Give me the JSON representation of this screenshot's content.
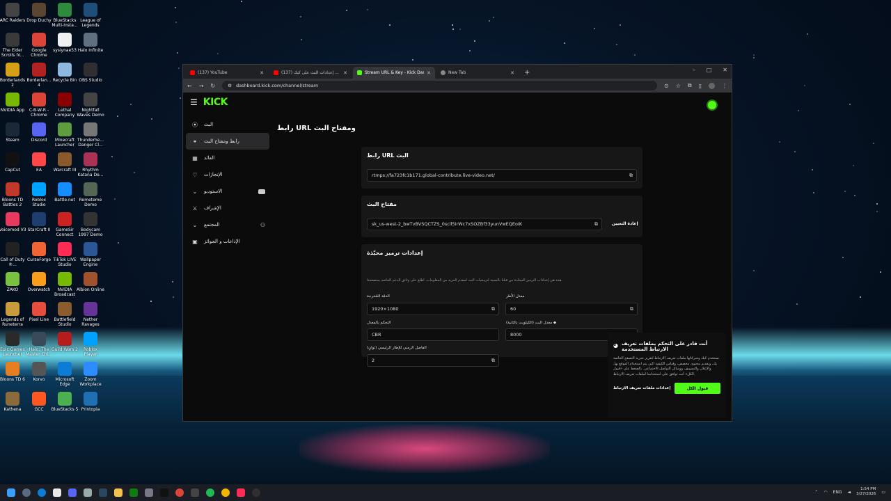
{
  "desktop_icons": [
    {
      "label": "ARC Raiders",
      "color": "#444444"
    },
    {
      "label": "Drop Duchy",
      "color": "#5a4630"
    },
    {
      "label": "BlueStacks Multi-Insta...",
      "color": "#2e8b3d"
    },
    {
      "label": "League of Legends",
      "color": "#1d4f7a"
    },
    {
      "label": "The Elder Scrolls IV...",
      "color": "#3a3a3a"
    },
    {
      "label": "Google Chrome",
      "color": "#db4437"
    },
    {
      "label": "sysiynae53",
      "color": "#f0f0f0"
    },
    {
      "label": "Halo Infinite",
      "color": "#607080"
    },
    {
      "label": "Borderlands 2",
      "color": "#d4a017"
    },
    {
      "label": "Borderlan... 4",
      "color": "#b22222"
    },
    {
      "label": "Recycle Bin",
      "color": "#8fb8de"
    },
    {
      "label": "OBS Studio",
      "color": "#302e31"
    },
    {
      "label": "NVIDIA App",
      "color": "#76b900"
    },
    {
      "label": "C-B-W-R - Chrome",
      "color": "#db4437"
    },
    {
      "label": "Lethal Company",
      "color": "#8b0000"
    },
    {
      "label": "Nightfall Waves Demo",
      "color": "#444444"
    },
    {
      "label": "Steam",
      "color": "#1b2838"
    },
    {
      "label": "Discord",
      "color": "#5865f2"
    },
    {
      "label": "Minecraft Launcher",
      "color": "#5d9c3f"
    },
    {
      "label": "Thunderhe... Danger Cl...",
      "color": "#777777"
    },
    {
      "label": "CapCut",
      "color": "#111111"
    },
    {
      "label": "EA",
      "color": "#ff4747"
    },
    {
      "label": "Warcraft III",
      "color": "#8b5a2b"
    },
    {
      "label": "Rhythm Katana De...",
      "color": "#aa3355"
    },
    {
      "label": "Bloons TD Battles 2",
      "color": "#c0392b"
    },
    {
      "label": "Roblox Studio",
      "color": "#00a2ff"
    },
    {
      "label": "Battle.net",
      "color": "#148eff"
    },
    {
      "label": "Remeteme Demo",
      "color": "#556655"
    },
    {
      "label": "Voicemod V3",
      "color": "#e83a5f"
    },
    {
      "label": "StarCraft II",
      "color": "#1d3e6e"
    },
    {
      "label": "GameSir Connect",
      "color": "#cc2222"
    },
    {
      "label": "Bodycam 1997 Demo",
      "color": "#333333"
    },
    {
      "label": "Call of Duty ®...",
      "color": "#222222"
    },
    {
      "label": "CurseForge",
      "color": "#f16436"
    },
    {
      "label": "TikTok LIVE Studio",
      "color": "#fe2c55"
    },
    {
      "label": "Wallpaper Engine",
      "color": "#2b5797"
    },
    {
      "label": "ZAKO",
      "color": "#7ac142"
    },
    {
      "label": "Overwatch",
      "color": "#f99e1a"
    },
    {
      "label": "NVIDIA Broadcast",
      "color": "#76b900"
    },
    {
      "label": "Albion Online",
      "color": "#a0522d"
    },
    {
      "label": "Legends of Runeterra",
      "color": "#c89b3c"
    },
    {
      "label": "Pixel Line",
      "color": "#e74c3c"
    },
    {
      "label": "Battlefield Studio",
      "color": "#8a5c2e"
    },
    {
      "label": "Nether Ravages",
      "color": "#663399"
    },
    {
      "label": "Epic Games Launcher",
      "color": "#2a2a2a"
    },
    {
      "label": "Halo: The Master Chi...",
      "color": "#3a4a5a"
    },
    {
      "label": "Guild Wars 2",
      "color": "#b71c1c"
    },
    {
      "label": "Roblox Player",
      "color": "#00a2ff"
    },
    {
      "label": "Bloons TD 6",
      "color": "#e67e22"
    },
    {
      "label": "Korvo",
      "color": "#555555"
    },
    {
      "label": "Microsoft Edge",
      "color": "#0c7cd5"
    },
    {
      "label": "Zoom Workplace",
      "color": "#2d8cff"
    },
    {
      "label": "Kathena",
      "color": "#8b6b3c"
    },
    {
      "label": "GCC",
      "color": "#ff5722"
    },
    {
      "label": "BlueStacks 5",
      "color": "#4caf50"
    },
    {
      "label": "Printopia",
      "color": "#1f6fb2"
    }
  ],
  "browser": {
    "tabs": [
      {
        "title": "(137) YouTube",
        "favicon_color": "#ff0000"
      },
      {
        "title": "(137) إعدادات البث على كيك ...",
        "favicon_color": "#ff0000"
      },
      {
        "title": "Stream URL & Key - Kick Dashl...",
        "favicon_color": "#53fc18"
      },
      {
        "title": "New Tab",
        "favicon_color": "#888888"
      }
    ],
    "new_tab_label": "+",
    "url": "dashboard.kick.com/channel/stream",
    "window_controls": {
      "minimize": "–",
      "maximize": "□",
      "close": "✕"
    }
  },
  "kick": {
    "logo": "KICK",
    "page_title": "رابط URL ومفتاح البث",
    "nav": [
      {
        "label": "البث",
        "icon": "((·))"
      },
      {
        "label": "رابط ومفتاح البث",
        "icon": "🔗"
      },
      {
        "label": "العائد",
        "icon": "▦"
      },
      {
        "label": "الإنجازات",
        "icon": "♡"
      },
      {
        "label": "الاستوديو",
        "icon": "▭"
      },
      {
        "label": "الإشراف",
        "icon": "⚔"
      },
      {
        "label": "المجتمع",
        "icon": "⚇"
      },
      {
        "label": "الإذاعات و الجوائز",
        "icon": "▣"
      }
    ],
    "url_card": {
      "title": "رابط URL البث",
      "value": "rtmps://fa723fc1b171.global-contribute.live-video.net/"
    },
    "key_card": {
      "title": "مفتاح البث",
      "value": "sk_us-west-2_bwTvBVSQCTZS_0scll5irWc7xSOZBf33yunVwEQEoIK",
      "reset_label": "إعادة التعيين"
    },
    "encoder_card": {
      "title": "إعدادات ترميز محبّذة",
      "description": "هذه هي إعدادات الترميز المحبّذة من قبلنا بالنسبة لبرمجيات البث لمقدم المزيد من المعلومات، اطلع على وثائق الدعم الخاصة بمتصفحنا.",
      "fields": [
        {
          "label": "معدل الأطر",
          "value": "60"
        },
        {
          "label": "الدقة المُخرجة",
          "value": "1920×1080"
        },
        {
          "label": "معدل البت (الكيلوبت بالثانية) ◆",
          "value": "8000"
        },
        {
          "label": "التحكم بالمعدل",
          "value": "CBR"
        },
        {
          "label": "الفاصل الزمني للإطار الرئيسي (ثوانٍ)",
          "value": "2"
        }
      ]
    },
    "cookie": {
      "title": "أنت قادر على التحكم بملفات تعريف الارتباط المستخدمة",
      "body": "نستخدم كيك وشركائها ملفات تعريف الارتباط لتعزيز تجربة التصفح الخاصة بك، وتقديم محتوى مخصص، وقياس الكيفية التي يتم استخدام الموقع بها، والإعلان والتسويق، ووسائل التواصل الاجتماعي. بالضغط على «قبول الكل» أنت توافق على استخدامنا لملفات تعريف الارتباط.",
      "settings_label": "إعدادات ملفات تعريف الارتباط",
      "accept_label": "قبول الكل"
    }
  },
  "taskbar": {
    "lang": "ENG",
    "time": "1:54 PM",
    "date": "3/27/2026"
  }
}
